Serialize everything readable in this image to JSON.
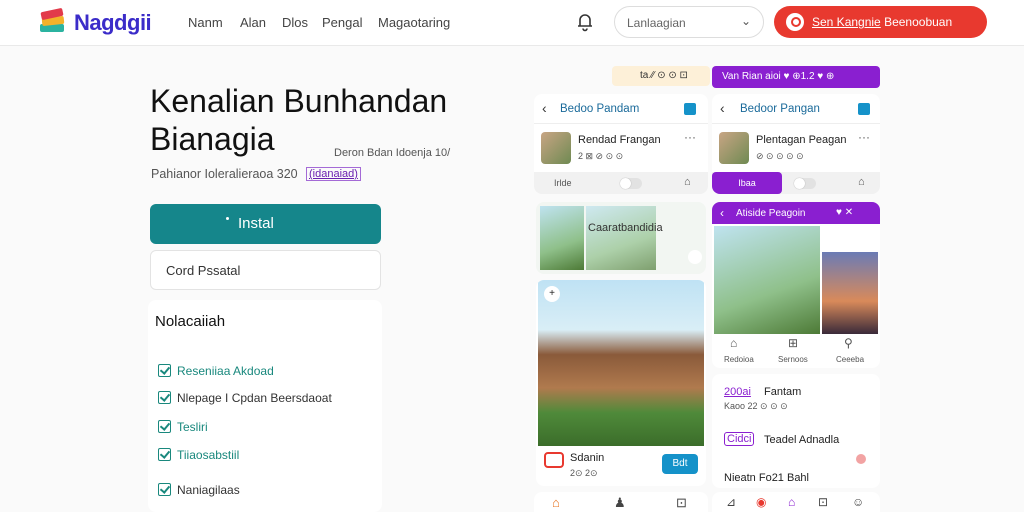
{
  "header": {
    "logo_text": "Nagdgii",
    "nav": [
      "Nanm",
      "Alan",
      "Dlos",
      "Pengal",
      "Magaotaring"
    ],
    "select_value": "Lanlaagian",
    "cta_label_underlined": "Sen Kangnie",
    "cta_label_rest": "Beenoobuan"
  },
  "hero": {
    "title_line1": "Kenalian Bunhandan",
    "title_line2": "Bianagia",
    "meta_left": "Pahianor Ioleralieraoa 320",
    "meta_tag": "(idanaiad)",
    "meta_right": "Deron Bdan Idoenja 10/",
    "install_label": "Instal",
    "code_placeholder": "Cord Pssatal"
  },
  "features": {
    "title": "Nolacaiiah",
    "items": [
      "Reseniiaa Akdoad",
      "Nlepage I Cpdan Beersdaoat",
      "Tesliri",
      "Tiiaosabstiil",
      "Naniagilaas"
    ]
  },
  "phone_left": {
    "strip": "ta ∕∕ ⊙ ⊙ ⊡",
    "title": "Bedoo Pandam",
    "item_title": "Rendad Frangan",
    "item_sub": "2 ⊠ ⊘ ⊙ ⊙",
    "row_label": "Irlde",
    "card2_title": "Caaratbandidia",
    "card3_title": "Sdanin",
    "card3_sub": "2⊙ 2⊙",
    "card3_btn": "Bdt"
  },
  "phone_right": {
    "strip": "Van Rian aioi ♥ ⊕1.2 ♥ ⊕",
    "title": "Bedoor Pangan",
    "item_title": "Plentagan Peagan",
    "item_sub": "⊘ ⊙ ⊙ ⊙ ⊙",
    "row_tag": "Ibaa",
    "card2_title": "Atiside Peagoin",
    "nav_labels": [
      "Redoioa",
      "Sernoos",
      "Ceeeba"
    ],
    "list1_title": "Fantam",
    "list1_code": "200ai",
    "list1_sub": "Kaoo 22 ⊙ ⊙ ⊙",
    "list2_tag": "Cidci",
    "list2_title": "Teadel Adnadla",
    "list3_title": "Nieatn Fo21 Bahl"
  },
  "colors": {
    "cta": "#e8392f",
    "install": "#15868b",
    "check": "#19887d",
    "purple": "#8a1fd0",
    "logo": "#3b2cc9"
  }
}
